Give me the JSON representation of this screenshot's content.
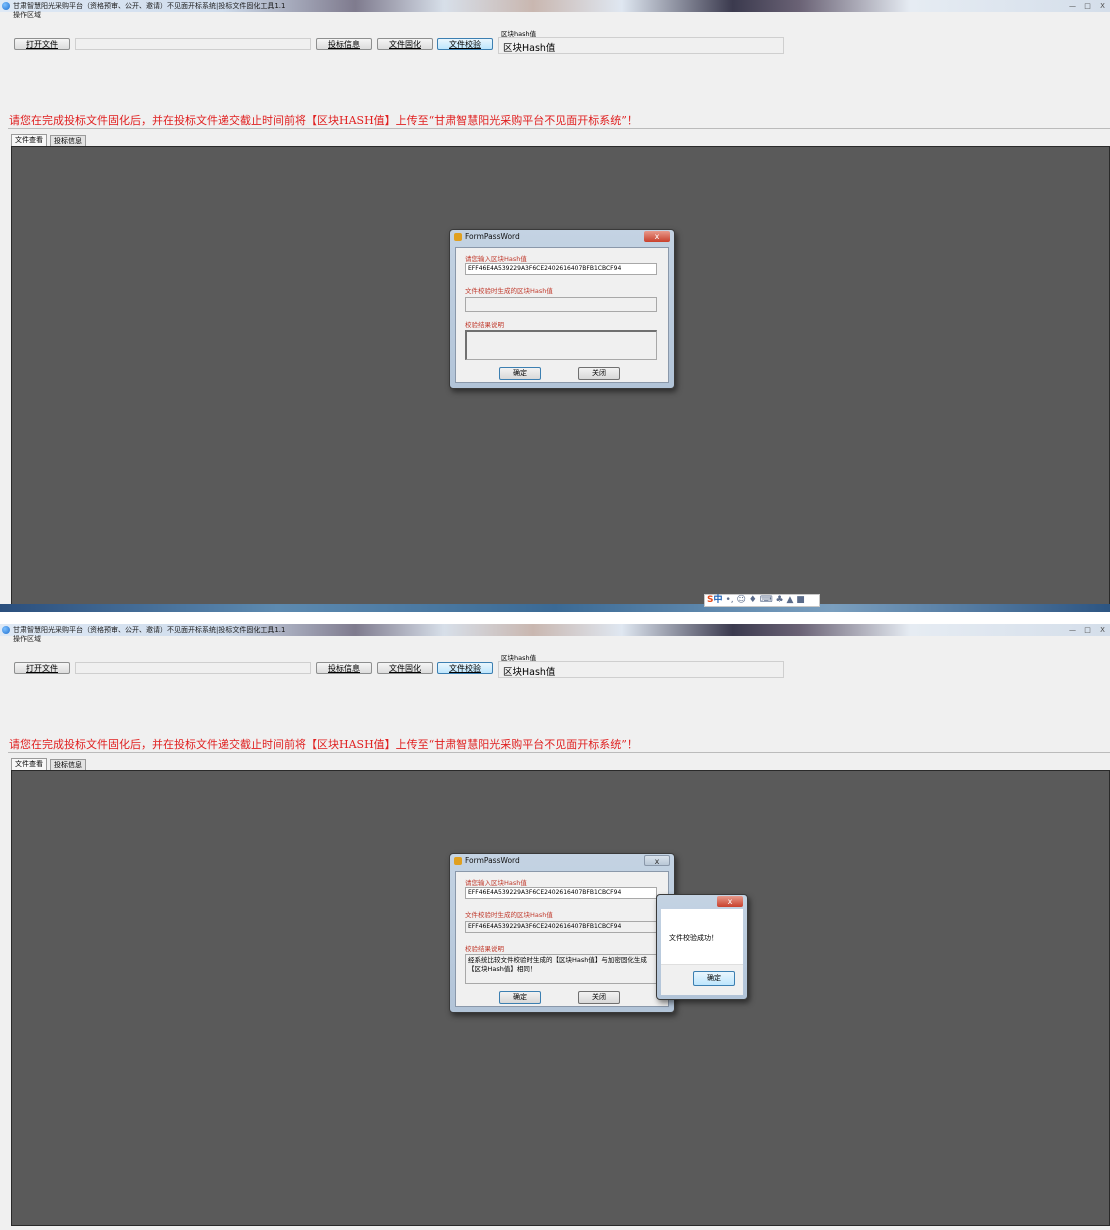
{
  "app": {
    "window_title": "甘肃智慧阳光采购平台（资格预审、公开、邀请）不见面开标系统|投标文件固化工具1.1",
    "window_controls": [
      "—",
      "□",
      "X"
    ],
    "operation_area_label": "操作区域",
    "toolbar": {
      "open_file": "打开文件",
      "bid_info": "投标信息",
      "file_solidify": "文件固化",
      "file_verify": "文件校验"
    },
    "hash_caption": "区块hash值",
    "hash_value": "区块Hash值",
    "notice": "请您在完成投标文件固化后，并在投标文件递交截止时间前将【区块HASH值】上传至“甘肃智慧阳光采购平台不见面开标系统”！",
    "tabs": [
      "文件查看",
      "投标信息"
    ]
  },
  "ime_bar": {
    "s": "S",
    "z": "中",
    "rest": "•, ☺ ♦ ⌨ ♣ ▲ ■"
  },
  "dialog": {
    "title": "FormPassWord",
    "close": "x",
    "label_input": "请您输入区块Hash值",
    "label_generated": "文件校验时生成的区块Hash值",
    "label_result": "校验结果说明",
    "ok": "确定",
    "cancel": "关闭"
  },
  "state1": {
    "input_hash": "EFF46E4A539229A3F6CE2402616407BFB1CBCF94",
    "generated_hash": "",
    "result": ""
  },
  "state2": {
    "input_hash": "EFF46E4A539229A3F6CE2402616407BFB1CBCF94",
    "generated_hash": "EFF46E4A539229A3F6CE2402616407BFB1CBCF94",
    "result": "经系统比较文件校验时生成的【区块Hash值】与加密固化生成【区块Hash值】相同！"
  },
  "msgbox": {
    "text": "文件校验成功！",
    "ok": "确定",
    "close": "x"
  }
}
